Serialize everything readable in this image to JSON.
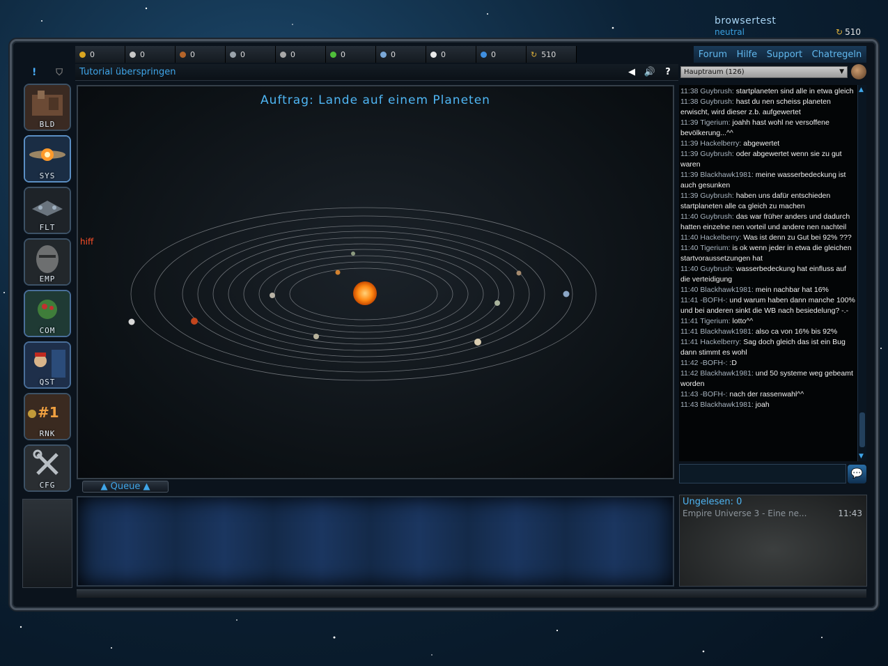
{
  "user": {
    "name": "browsertest",
    "status": "neutral",
    "credits": "510"
  },
  "resources": [
    {
      "icon": "gold-ore-icon",
      "value": "0",
      "color": "#d9a520"
    },
    {
      "icon": "crystal-icon",
      "value": "0",
      "color": "#c7c7c7"
    },
    {
      "icon": "copper-ore-icon",
      "value": "0",
      "color": "#b5652a"
    },
    {
      "icon": "metal-icon",
      "value": "0",
      "color": "#9aa3ab"
    },
    {
      "icon": "alloy-icon",
      "value": "0",
      "color": "#a8a8a8"
    },
    {
      "icon": "plant-icon",
      "value": "0",
      "color": "#4fbf3a"
    },
    {
      "icon": "gem-icon",
      "value": "0",
      "color": "#7aa8d8"
    },
    {
      "icon": "water-icon",
      "value": "0",
      "color": "#eaeaea"
    },
    {
      "icon": "energy-icon",
      "value": "0",
      "color": "#3f8fe0"
    },
    {
      "icon": "credits-icon",
      "value": "510",
      "color": "#e0b23a"
    }
  ],
  "nav": {
    "forum": "Forum",
    "help": "Hilfe",
    "support": "Support",
    "chatrules": "Chatregeln"
  },
  "toolbar": {
    "tutorial": "Tutorial überspringen",
    "back": "◀",
    "sound": "🔊",
    "help": "?"
  },
  "chat_room": "Hauptraum (126)",
  "sidenav": [
    {
      "label": "BLD",
      "name": "buildings"
    },
    {
      "label": "SYS",
      "name": "system"
    },
    {
      "label": "FLT",
      "name": "fleet"
    },
    {
      "label": "EMP",
      "name": "empire"
    },
    {
      "label": "COM",
      "name": "communication"
    },
    {
      "label": "QST",
      "name": "quests"
    },
    {
      "label": "RNK",
      "name": "ranking",
      "badge": "#1"
    },
    {
      "label": "CFG",
      "name": "config"
    }
  ],
  "mission": {
    "title": "Auftrag: Lande auf einem Planeten",
    "marker": "hiff"
  },
  "queue": "▲ Queue ▲",
  "chat": [
    {
      "meta": "11:38 Guybrush:",
      "text": " startplaneten sind alle in etwa gleich"
    },
    {
      "meta": "11:38 Guybrush:",
      "text": " hast du nen scheiss planeten erwischt, wird dieser z.b. aufgewertet"
    },
    {
      "meta": "11:39 Tigerium:",
      "text": " joahh hast wohl ne versoffene bevölkerung...^^"
    },
    {
      "meta": "11:39 Hackelberry:",
      "text": " abgewertet"
    },
    {
      "meta": "11:39 Guybrush:",
      "text": " oder abgewertet wenn sie zu gut waren"
    },
    {
      "meta": "11:39 Blackhawk1981:",
      "text": " meine wasserbedeckung ist auch gesunken"
    },
    {
      "meta": "11:39 Guybrush:",
      "text": " haben uns dafür entschieden startplaneten alle ca gleich zu machen"
    },
    {
      "meta": "11:40 Guybrush:",
      "text": " das war früher anders und dadurch hatten einzelne nen vorteil und andere nen nachteil"
    },
    {
      "meta": "11:40 Hackelberry:",
      "text": " Was ist denn zu Gut bei 92% ???"
    },
    {
      "meta": "11:40 Tigerium:",
      "text": " is ok wenn jeder in etwa die gleichen startvoraussetzungen hat"
    },
    {
      "meta": "11:40 Guybrush:",
      "text": " wasserbedeckung hat einfluss auf die verteidigung"
    },
    {
      "meta": "11:40 Blackhawk1981:",
      "text": " mein nachbar hat 16%"
    },
    {
      "meta": "11:41 -BOFH-:",
      "text": " und warum haben dann manche 100% und bei anderen sinkt die WB nach besiedelung? -.-"
    },
    {
      "meta": "11:41 Tigerium:",
      "text": " lotto^^"
    },
    {
      "meta": "11:41 Blackhawk1981:",
      "text": " also ca von 16% bis 92%"
    },
    {
      "meta": "11:41 Hackelberry:",
      "text": " Sag doch gleich das ist ein Bug dann stimmt es wohl"
    },
    {
      "meta": "11:42 -BOFH-:",
      "text": " :D"
    },
    {
      "meta": "11:42 Blackhawk1981:",
      "text": " und 50 systeme weg gebeamt worden"
    },
    {
      "meta": "11:43 -BOFH-:",
      "text": " nach der rassenwahl^^"
    },
    {
      "meta": "11:43 Blackhawk1981:",
      "text": " joah"
    }
  ],
  "messages": {
    "unread": "Ungelesen: 0",
    "latest_subject": "Empire Universe 3 - Eine ne...",
    "latest_time": "11:43"
  }
}
